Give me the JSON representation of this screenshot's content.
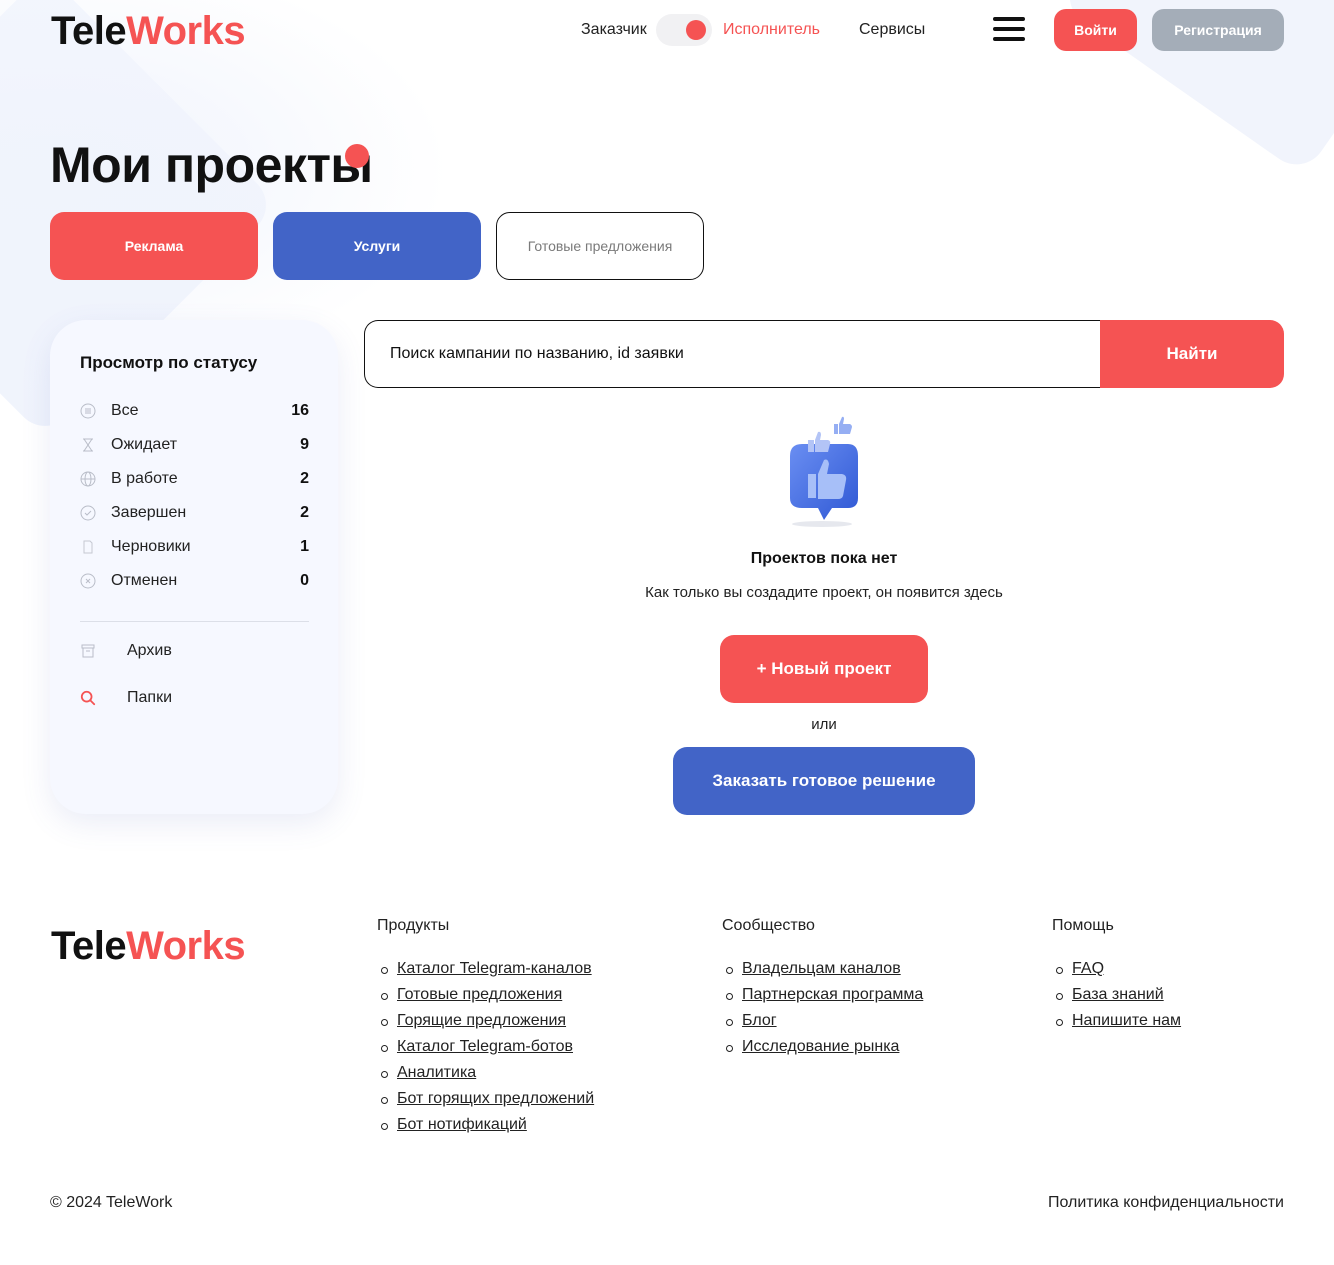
{
  "header": {
    "logo_part1": "Tele",
    "logo_part2": "Works",
    "role_customer": "Заказчик",
    "role_executor": "Исполнитель",
    "services": "Сервисы",
    "login": "Войти",
    "register": "Регистрация"
  },
  "page": {
    "title": "Мои проекты"
  },
  "tabs": [
    {
      "label": "Реклама"
    },
    {
      "label": "Услуги"
    },
    {
      "label": "Готовые предложения"
    }
  ],
  "sidebar": {
    "title": "Просмотр по статусу",
    "statuses": [
      {
        "label": "Все",
        "count": "16",
        "icon": "list-icon"
      },
      {
        "label": "Ожидает",
        "count": "9",
        "icon": "hourglass-icon"
      },
      {
        "label": "В работе",
        "count": "2",
        "icon": "globe-icon"
      },
      {
        "label": "Завершен",
        "count": "2",
        "icon": "check-circle-icon"
      },
      {
        "label": "Черновики",
        "count": "1",
        "icon": "document-icon"
      },
      {
        "label": "Отменен",
        "count": "0",
        "icon": "cancel-circle-icon"
      }
    ],
    "archive": "Архив",
    "folders": "Папки"
  },
  "search": {
    "placeholder": "Поиск кампании по названию, id заявки",
    "button": "Найти"
  },
  "empty_state": {
    "title": "Проектов пока нет",
    "subtitle": "Как только вы создадите проект, он появится здесь",
    "new_project": "+ Новый проект",
    "or": "или",
    "order_solution": "Заказать готовое решение"
  },
  "footer": {
    "logo_part1": "Tele",
    "logo_part2": "Works",
    "columns": [
      {
        "title": "Продукты",
        "links": [
          "Каталог Telegram-каналов",
          "Готовые предложения",
          "Горящие предложения",
          "Каталог Telegram-ботов",
          "Аналитика",
          "Бот горящих предложений",
          "Бот нотификаций"
        ]
      },
      {
        "title": "Сообщество",
        "links": [
          "Владельцам каналов",
          "Партнерская программа",
          "Блог",
          "Исследование рынка"
        ]
      },
      {
        "title": "Помощь",
        "links": [
          "FAQ",
          "База знаний",
          "Напишите нам"
        ]
      }
    ],
    "copyright": "© 2024 TeleWork",
    "privacy": "Политика конфиденциальности"
  },
  "colors": {
    "accent_red": "#f55353",
    "accent_blue": "#4264c7",
    "muted_gray": "#a4adb8"
  }
}
